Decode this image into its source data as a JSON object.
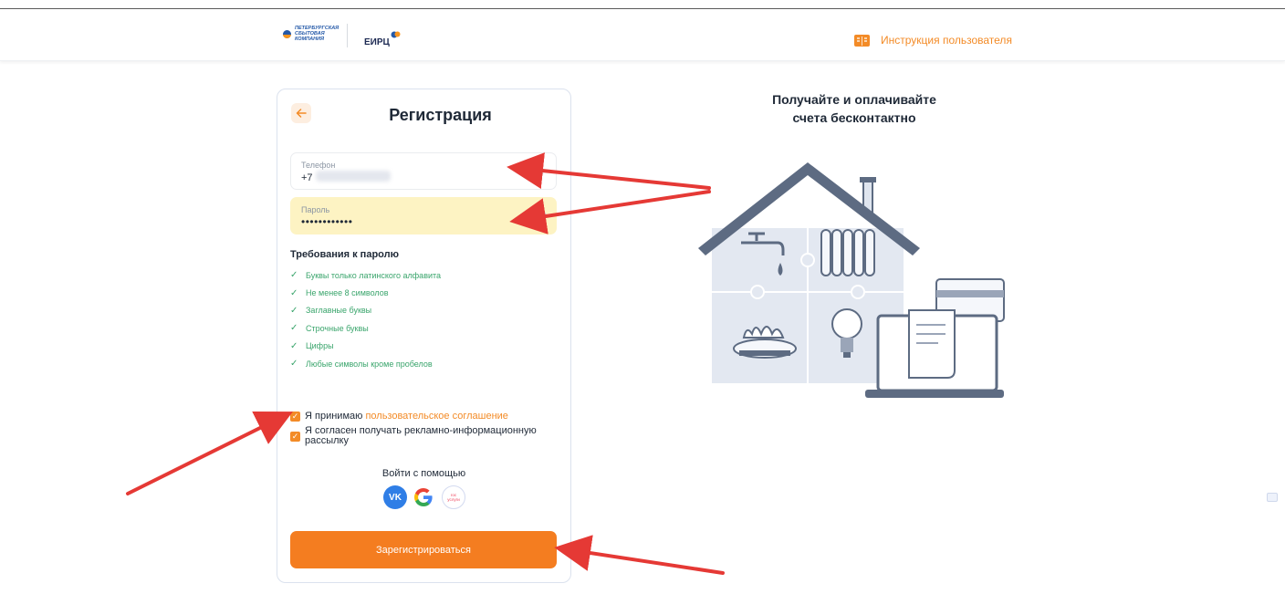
{
  "header": {
    "psk_logo_text": "ПЕТЕРБУРГСКАЯ\nСБЫТОВАЯ\nКОМПАНИЯ",
    "eirc_logo_text": "ЕИРЦ",
    "guide_link": "Инструкция пользователя"
  },
  "form": {
    "title": "Регистрация",
    "phone": {
      "label": "Телефон",
      "value": "+7"
    },
    "password": {
      "label": "Пароль",
      "value": "••••••••••••"
    },
    "requirements_title": "Требования к паролю",
    "requirements": [
      "Буквы только латинского алфавита",
      "Не менее 8 символов",
      "Заглавные буквы",
      "Строчные буквы",
      "Цифры",
      "Любые символы кроме пробелов"
    ],
    "agreement_prefix": "Я принимаю ",
    "agreement_link": "пользовательское соглашение",
    "newsletter": "Я согласен получать рекламно-информационную рассылку",
    "login_with": "Войти с помощью",
    "social": {
      "vk": "VK",
      "gosuslugi": "гос услуги"
    },
    "submit": "Зарегистрироваться"
  },
  "promo": {
    "line1": "Получайте и оплачивайте",
    "line2": "счета бесконтактно"
  },
  "colors": {
    "accent": "#f47d20",
    "success": "#3aa56c",
    "autofill": "#fdf3c3",
    "annotation": "#e53935"
  }
}
